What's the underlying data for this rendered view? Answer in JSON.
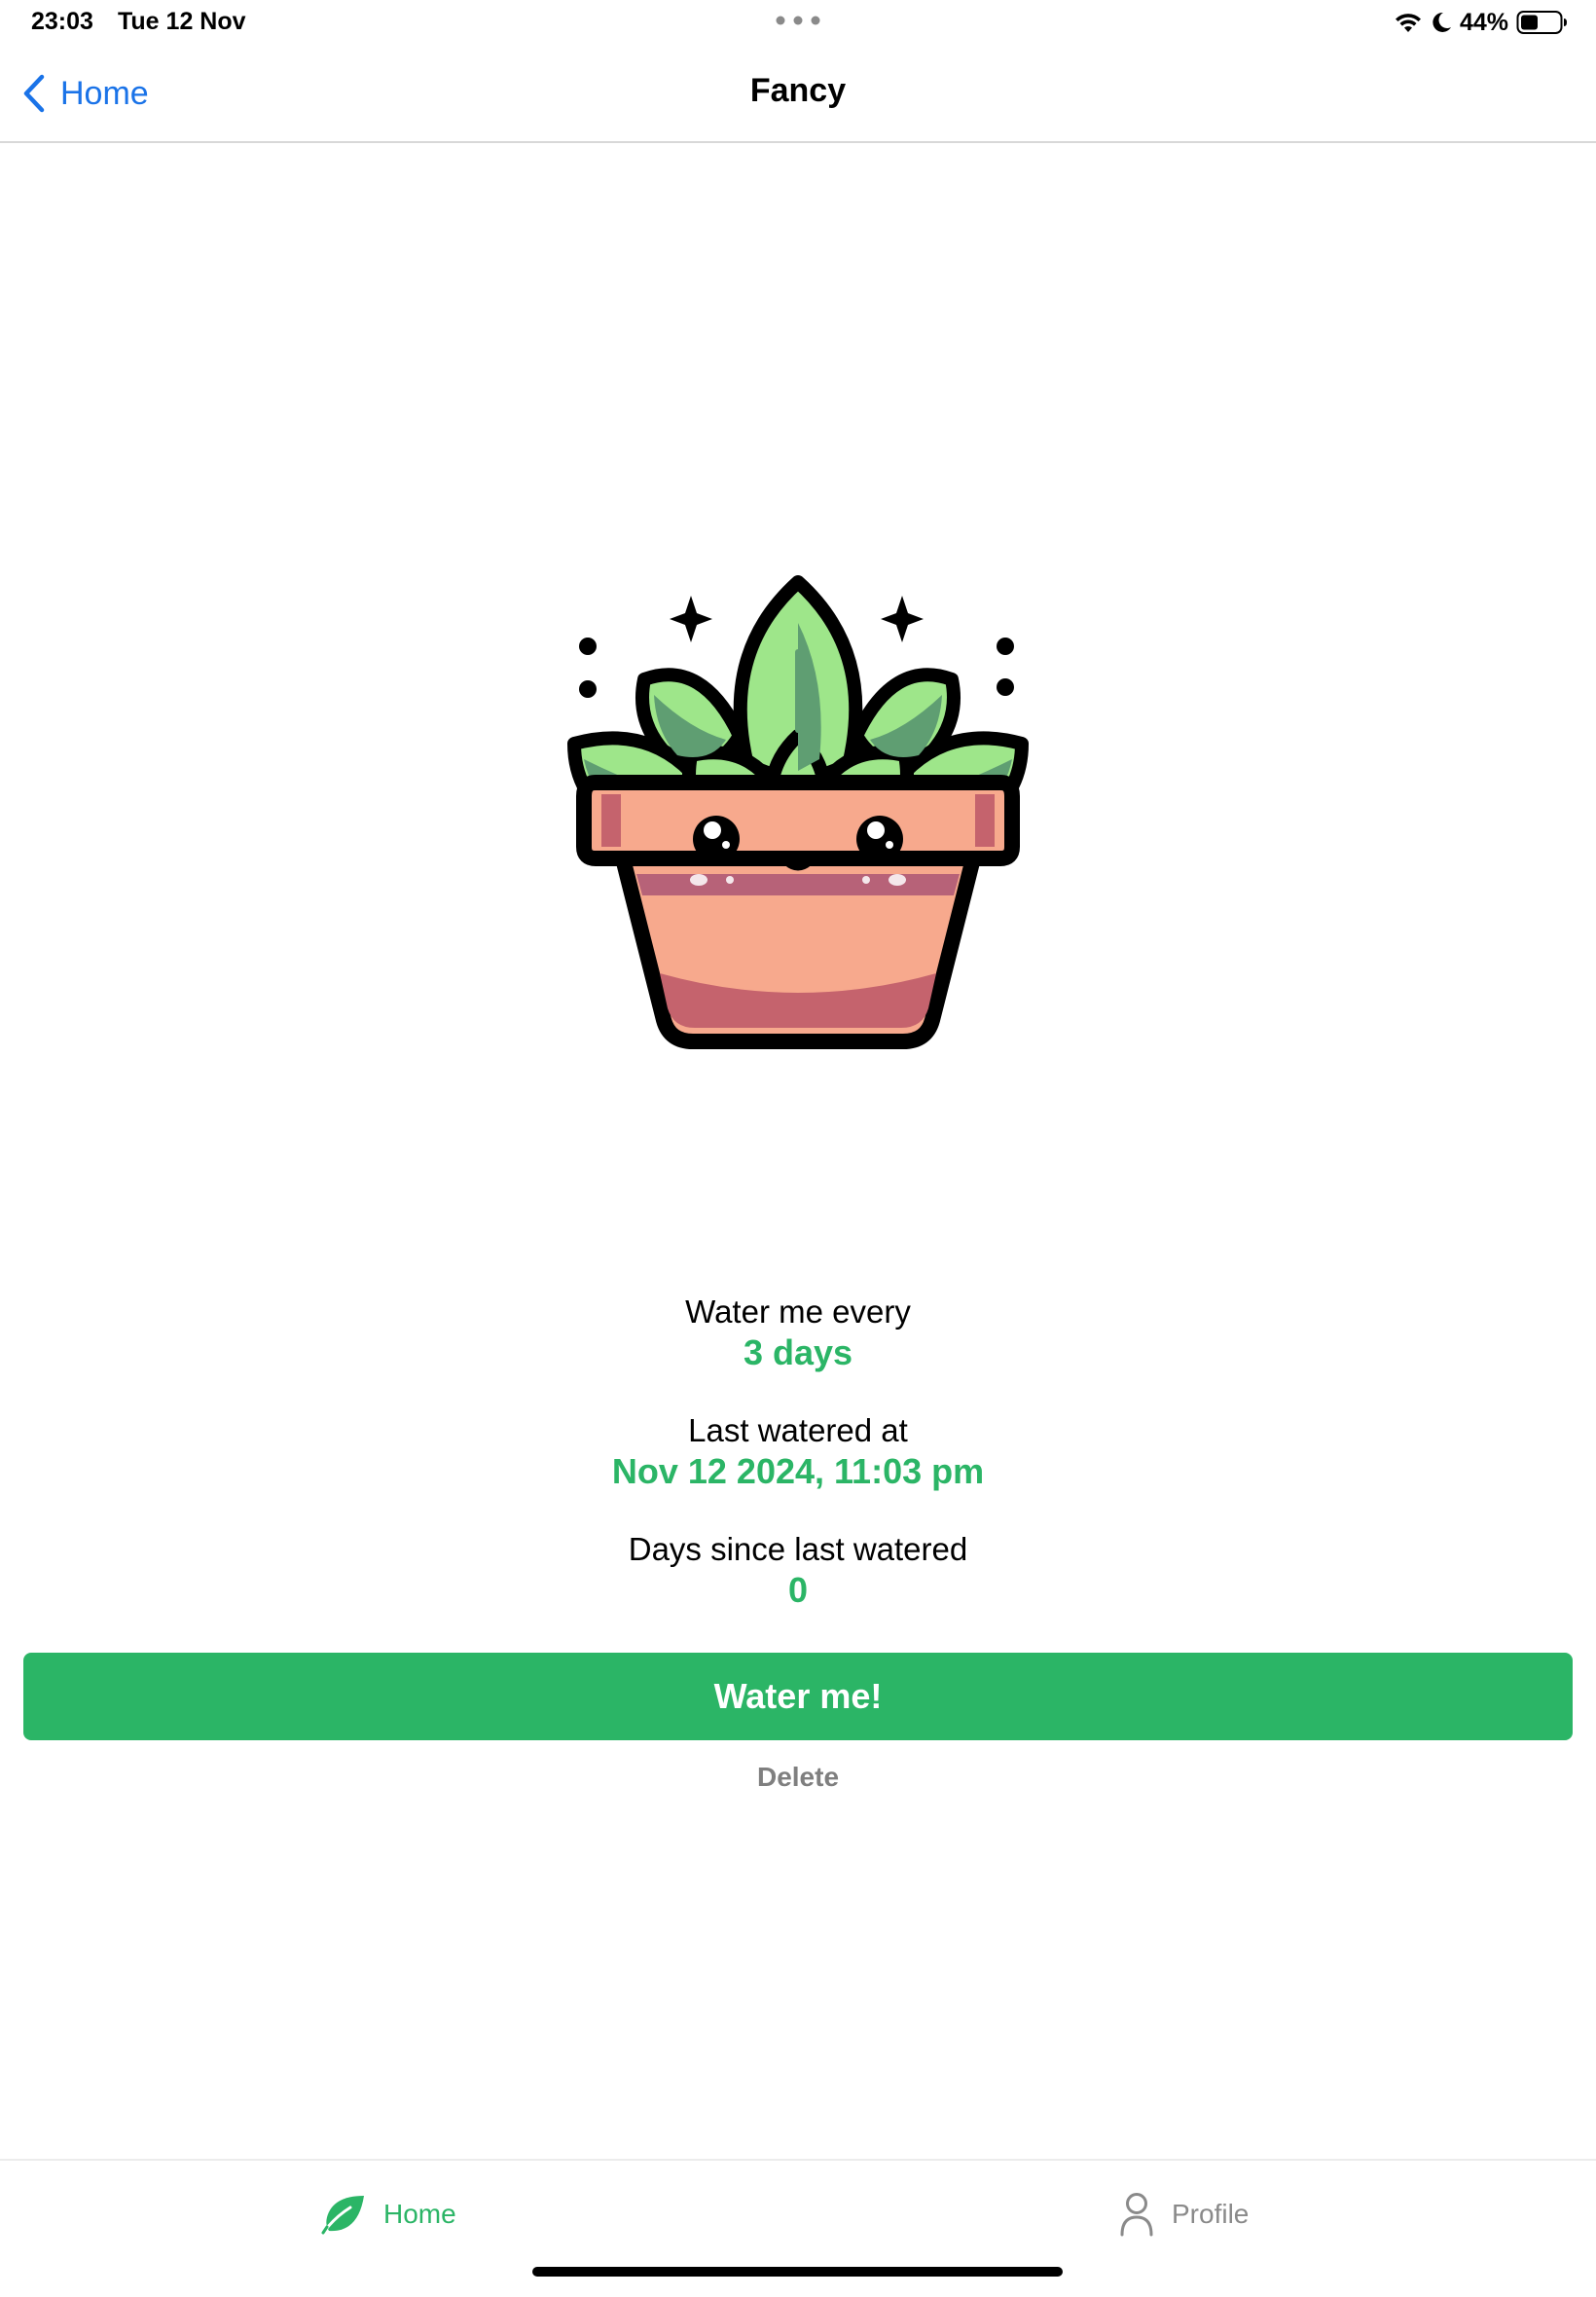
{
  "status_bar": {
    "time": "23:03",
    "date": "Tue 12 Nov",
    "battery": "44%",
    "icons": [
      "multitask-dots-icon",
      "wifi-icon",
      "moon-icon",
      "battery-icon"
    ]
  },
  "nav": {
    "back_label": "Home",
    "title": "Fancy"
  },
  "plant": {
    "icon": "potted-succulent-illustration"
  },
  "info": {
    "frequency_label": "Water me every",
    "frequency_value": "3 days",
    "last_watered_label": "Last watered at",
    "last_watered_value": "Nov 12 2024, 11:03 pm",
    "days_since_label": "Days since last watered",
    "days_since_value": "0"
  },
  "actions": {
    "water_label": "Water me!",
    "delete_label": "Delete"
  },
  "tabs": [
    {
      "label": "Home",
      "icon": "leaf-icon",
      "active": true
    },
    {
      "label": "Profile",
      "icon": "person-icon",
      "active": false
    }
  ],
  "colors": {
    "accent": "#2bb566",
    "link": "#1a73e8",
    "muted": "#7f7f7f"
  }
}
